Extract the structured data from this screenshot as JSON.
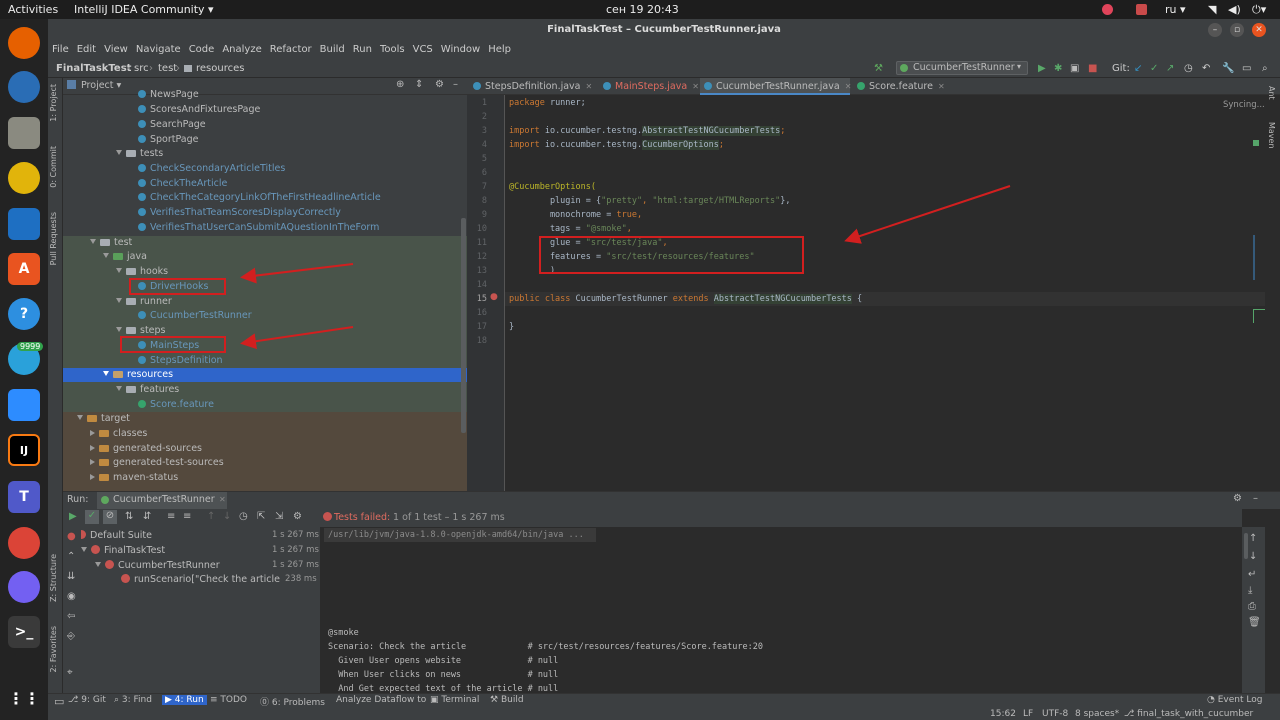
{
  "topbar": {
    "activities": "Activities",
    "app_menu": "IntelliJ IDEA Community ▾",
    "clock": "сен 19  20:43",
    "lang": "ru ▾"
  },
  "dock": {
    "telegram_badge": "9999",
    "intellij_label": "IJ"
  },
  "window": {
    "title": "FinalTaskTest – CucumberTestRunner.java"
  },
  "menu": [
    "File",
    "Edit",
    "View",
    "Navigate",
    "Code",
    "Analyze",
    "Refactor",
    "Build",
    "Run",
    "Tools",
    "VCS",
    "Window",
    "Help"
  ],
  "breadcrumb": {
    "project": "FinalTaskTest",
    "src": "src",
    "test": "test",
    "resources": "resources"
  },
  "run_config": "CucumberTestRunner",
  "git_label": "Git:",
  "left_tabs": {
    "project": "1: Project",
    "commit": "0: Commit",
    "pull": "Pull Requests",
    "structure": "Z: Structure",
    "favorites": "2: Favorites"
  },
  "right_tabs": {
    "ant": "Ant",
    "maven": "Maven"
  },
  "project_panel": {
    "title": "Project ▾",
    "rows": [
      {
        "label": "NewsPage",
        "kind": "class"
      },
      {
        "label": "ScoresAndFixturesPage",
        "kind": "class"
      },
      {
        "label": "SearchPage",
        "kind": "class"
      },
      {
        "label": "SportPage",
        "kind": "class"
      },
      {
        "label": "tests",
        "kind": "folder"
      },
      {
        "label": "CheckSecondaryArticleTitles",
        "kind": "class"
      },
      {
        "label": "CheckTheArticle",
        "kind": "class"
      },
      {
        "label": "CheckTheCategoryLinkOfTheFirstHeadlineArticle",
        "kind": "class"
      },
      {
        "label": "VerifiesThatTeamScoresDisplayCorrectly",
        "kind": "class"
      },
      {
        "label": "VerifiesThatUserCanSubmitAQuestionInTheForm",
        "kind": "class"
      },
      {
        "label": "test",
        "kind": "folder"
      },
      {
        "label": "java",
        "kind": "folder"
      },
      {
        "label": "hooks",
        "kind": "folder"
      },
      {
        "label": "DriverHooks",
        "kind": "class"
      },
      {
        "label": "runner",
        "kind": "folder"
      },
      {
        "label": "CucumberTestRunner",
        "kind": "class"
      },
      {
        "label": "steps",
        "kind": "folder"
      },
      {
        "label": "MainSteps",
        "kind": "class"
      },
      {
        "label": "StepsDefinition",
        "kind": "class"
      },
      {
        "label": "resources",
        "kind": "folder"
      },
      {
        "label": "features",
        "kind": "folder"
      },
      {
        "label": "Score.feature",
        "kind": "feature"
      },
      {
        "label": "target",
        "kind": "folder"
      },
      {
        "label": "classes",
        "kind": "folder"
      },
      {
        "label": "generated-sources",
        "kind": "folder"
      },
      {
        "label": "generated-test-sources",
        "kind": "folder"
      },
      {
        "label": "maven-status",
        "kind": "folder"
      }
    ]
  },
  "editor": {
    "tabs": [
      "StepsDefinition.java",
      "MainSteps.java",
      "CucumberTestRunner.java",
      "Score.feature"
    ],
    "status": "Syncing...",
    "line_numbers": [
      "1",
      "2",
      "3",
      "4",
      "5",
      "6",
      "7",
      "8",
      "9",
      "10",
      "11",
      "12",
      "13",
      "14",
      "15",
      "16",
      "17",
      "18"
    ],
    "code": {
      "l1a": "package",
      "l1b": " runner;",
      "l3a": "import",
      "l3b": " io.cucumber.testng.",
      "l3c": "AbstractTestNGCucumberTests",
      "l3d": ";",
      "l4a": "import",
      "l4b": " io.cucumber.testng.",
      "l4c": "CucumberOptions",
      "l4d": ";",
      "l7": "@CucumberOptions(",
      "l8a": "        plugin = {",
      "l8b": "\"pretty\"",
      "l8c": ", ",
      "l8d": "\"html:target/HTMLReports\"",
      "l8e": "},",
      "l9a": "        monochrome = ",
      "l9b": "true",
      "l9c": ",",
      "l10a": "        tags = ",
      "l10b": "\"@smoke\"",
      "l10c": ",",
      "l11a": "        glue = ",
      "l11b": "\"src/test/java\"",
      "l11c": ",",
      "l12a": "        features = ",
      "l12b": "\"src/test/resources/features\"",
      "l13": "        )",
      "l15a": "public class",
      "l15b": " CucumberTestRunner ",
      "l15c": "extends",
      "l15d": " ",
      "l15e": "AbstractTestNGCucumberTests",
      "l15f": " {",
      "l17": "}"
    }
  },
  "run_panel": {
    "label": "Run:",
    "tab": "CucumberTestRunner",
    "status_prefix": "Tests failed:",
    "status_rest": " 1 of 1 test – 1 s 267 ms",
    "tree": [
      {
        "label": "Default Suite",
        "time": "1 s 267 ms"
      },
      {
        "label": "FinalTaskTest",
        "time": "1 s 267 ms"
      },
      {
        "label": "CucumberTestRunner",
        "time": "1 s 267 ms"
      },
      {
        "label": "runScenario[\"Check the article",
        "time": "238 ms"
      }
    ],
    "console": {
      "cmd": "/usr/lib/jvm/java-1.8.0-openjdk-amd64/bin/java ...",
      "tag": "@smoke",
      "l1": "Scenario: Check the article            # src/test/resources/features/Score.feature:20",
      "l2": "  Given User opens website             # null",
      "l3": "  When User clicks on news             # null",
      "l4": "  And Get expected text of the article # null"
    }
  },
  "statusbar": {
    "git": "9: Git",
    "find": "3: Find",
    "run": "4: Run",
    "todo": "TODO",
    "problems": "6: Problems",
    "dataflow": "Analyze Dataflow to",
    "terminal": "Terminal",
    "build": "Build",
    "event_log": "Event Log",
    "position": "15:62",
    "line_sep": "LF",
    "encoding": "UTF-8",
    "indent": "8 spaces*",
    "branch": "final_task_with_cucumber"
  }
}
